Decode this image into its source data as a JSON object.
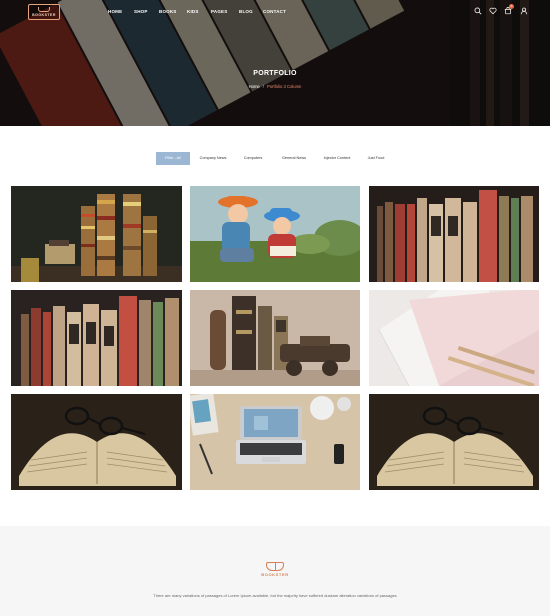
{
  "brand": {
    "logo_text": "BOOKSTER"
  },
  "nav": {
    "items": [
      "HOME",
      "SHOP",
      "BOOKS",
      "KIDS",
      "PAGES",
      "BLOG",
      "CONTACT"
    ],
    "cart_count": "0"
  },
  "icons": [
    "search-icon",
    "heart-icon",
    "cart-icon",
    "user-icon"
  ],
  "hero": {
    "title": "PORTFOLIO",
    "breadcrumb": {
      "home": "Home",
      "separator": "/",
      "current": "Portfolio 3 Column"
    }
  },
  "filters": [
    "Filter - All",
    "Company News",
    "Computers",
    "General News",
    "Injector Content",
    "Just Food"
  ],
  "portfolio": {
    "tiles": [
      "stacked-books-desk-image",
      "kids-reading-outdoors-image",
      "bookshelf-spines-image",
      "bookshelf-spines-image",
      "old-books-camera-image",
      "notebooks-pencils-image",
      "open-book-glasses-image",
      "laptop-desk-image",
      "open-book-glasses-image"
    ]
  },
  "footer": {
    "logo_text": "BOOKSTER",
    "text": "There are many variations of passages of Lorem Ipsum available, but the majority have suffered duskam alteration variations of passages"
  },
  "colors": {
    "accent": "#e8866a",
    "filter_active": "#9bb7d4",
    "footer_bg": "#f6f6f6",
    "logo": "#d58156"
  }
}
